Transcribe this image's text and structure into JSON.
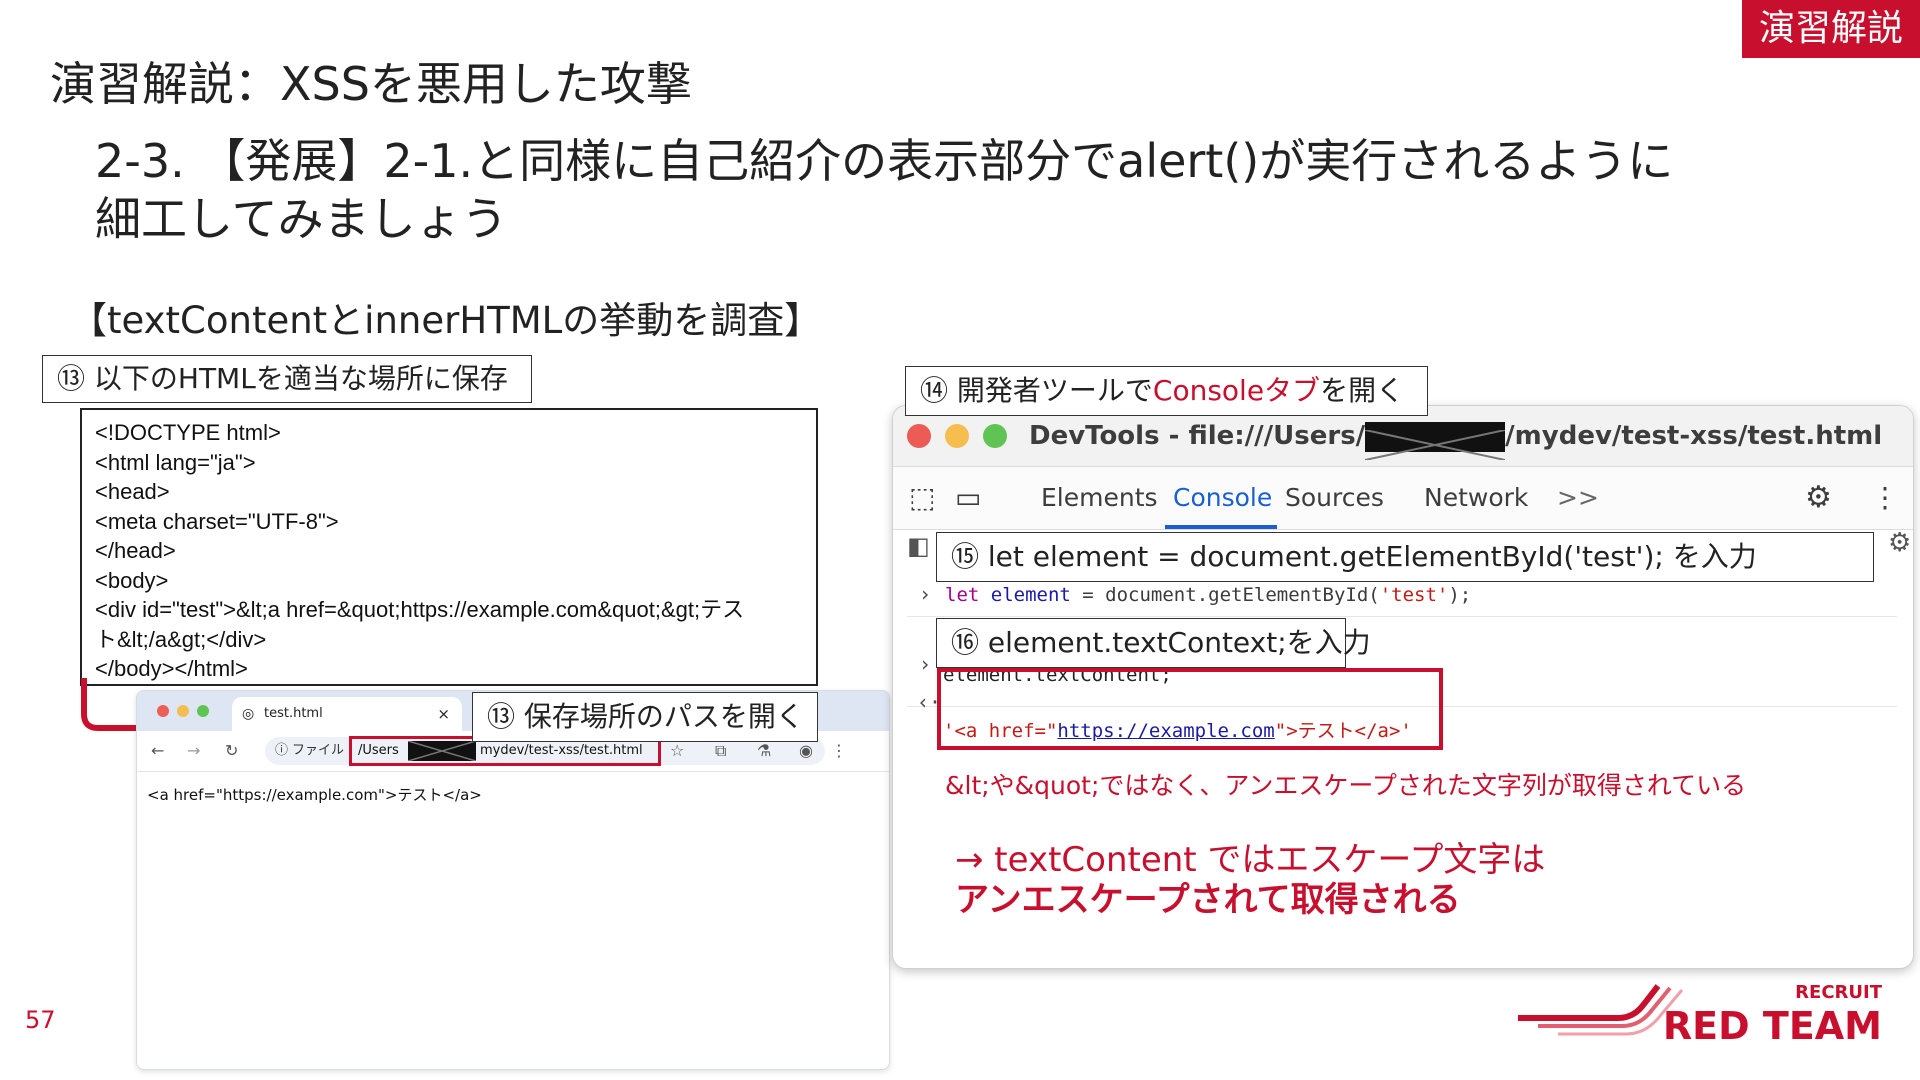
{
  "corner_tag": "演習解説",
  "title": "演習解説：XSSを悪用した攻撃",
  "subtitle_line1": "2-3. 【発展】2-1.と同様に自己紹介の表示部分でalert()が実行されるように",
  "subtitle_line2": "細工してみましょう",
  "section_heading": "【textContentとinnerHTMLの挙動を調査】",
  "step13a": "⑬ 以下のHTMLを適当な場所に保存",
  "code_lines": [
    "<!DOCTYPE html>",
    "<html lang=\"ja\">",
    "<head>",
    "<meta charset=\"UTF-8\">",
    "</head>",
    "<body>",
    "<div id=\"test\">&lt;a href=&quot;https://example.com&quot;&gt;テス",
    "ト&lt;/a&gt;</div>",
    "</body></html>"
  ],
  "step13b": "⑬ 保存場所のパスを開く",
  "browser": {
    "tab_title": "test.html",
    "close_glyph": "×",
    "file_label": "ファイル",
    "url_prefix": "/Users",
    "url_suffix": "mydev/test-xss/test.html",
    "page_text": "<a href=\"https://example.com\">テスト</a>"
  },
  "step14_prefix": "⑭ 開発者ツールで",
  "step14_highlight": "Consoleタブ",
  "step14_suffix": "を開く",
  "devtools": {
    "title_prefix": "DevTools - file:///Users/",
    "title_suffix": "/mydev/test-xss/test.html",
    "tabs": [
      "Elements",
      "Console",
      "Sources",
      "Network"
    ],
    "more": ">>",
    "console_line1_kw": "let",
    "console_line1_var": "element",
    "console_line1_rest": " = document.getElementById(",
    "console_line1_str": "'test'",
    "console_line1_end": ");",
    "console_line2": "element.textContent;",
    "console_result_q1": "'",
    "console_result_a": "<a href=\"",
    "console_result_link": "https://example.com",
    "console_result_b": "\">テスト</a>",
    "console_result_q2": "'"
  },
  "step15": "⑮ let element = document.getElementById('test'); を入力",
  "step16": "⑯ element.textContext;を入力",
  "note_red": "&lt;や&quot;ではなく、アンエスケープされた文字列が取得されている",
  "conclusion_line1": "→ textContent ではエスケープ文字は",
  "conclusion_line2": "アンエスケープされて取得される",
  "page_number": "57",
  "logo_small": "RECRUIT",
  "logo_big": "RED TEAM",
  "colors": {
    "accent": "#c8102e"
  }
}
